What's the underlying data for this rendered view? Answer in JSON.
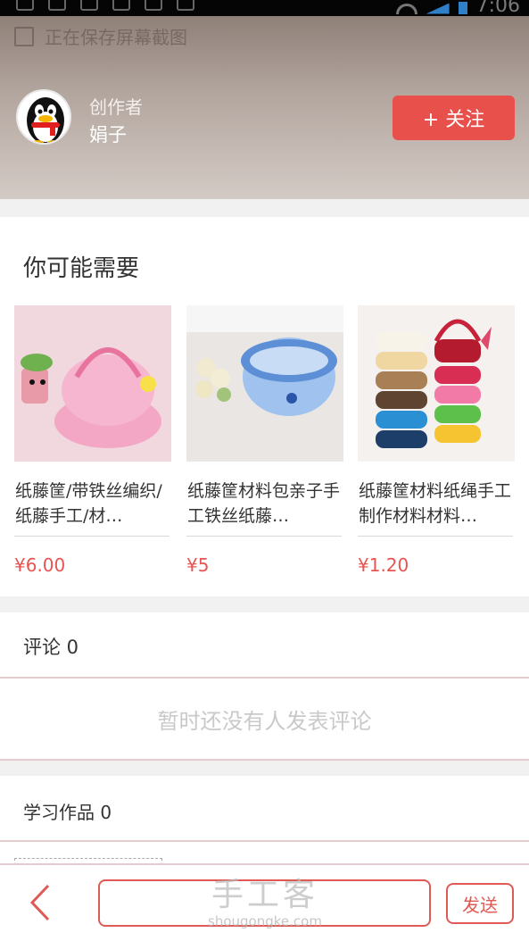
{
  "status_bar": {
    "time": "7:06"
  },
  "hero": {
    "save_hint": "正在保存屏幕截图",
    "creator_label": "创作者",
    "creator_name": "娟子",
    "follow_label": "+ 关注",
    "avatar_icon": "qq-penguin-avatar"
  },
  "recommend": {
    "title": "你可能需要",
    "products": [
      {
        "name": "纸藤筐/带铁丝编织/纸藤手工/材…",
        "price": "¥6.00",
        "image": "pink-woven-basket"
      },
      {
        "name": "纸藤筐材料包亲子手工铁丝纸藤…",
        "price": "¥5",
        "image": "blue-woven-basket"
      },
      {
        "name": "纸藤筐材料纸绳手工制作材料材料…",
        "price": "¥1.20",
        "image": "paper-rope-rolls"
      }
    ]
  },
  "comments": {
    "header": "评论 0",
    "empty_text": "暂时还没有人发表评论"
  },
  "works": {
    "header": "学习作品 0"
  },
  "bottom_bar": {
    "send_label": "发送",
    "input_value": "",
    "back_icon": "chevron-left-icon"
  },
  "watermark": {
    "main": "手工客",
    "sub": "shougongke.com"
  },
  "colors": {
    "accent": "#e8504b",
    "price": "#e65552"
  }
}
